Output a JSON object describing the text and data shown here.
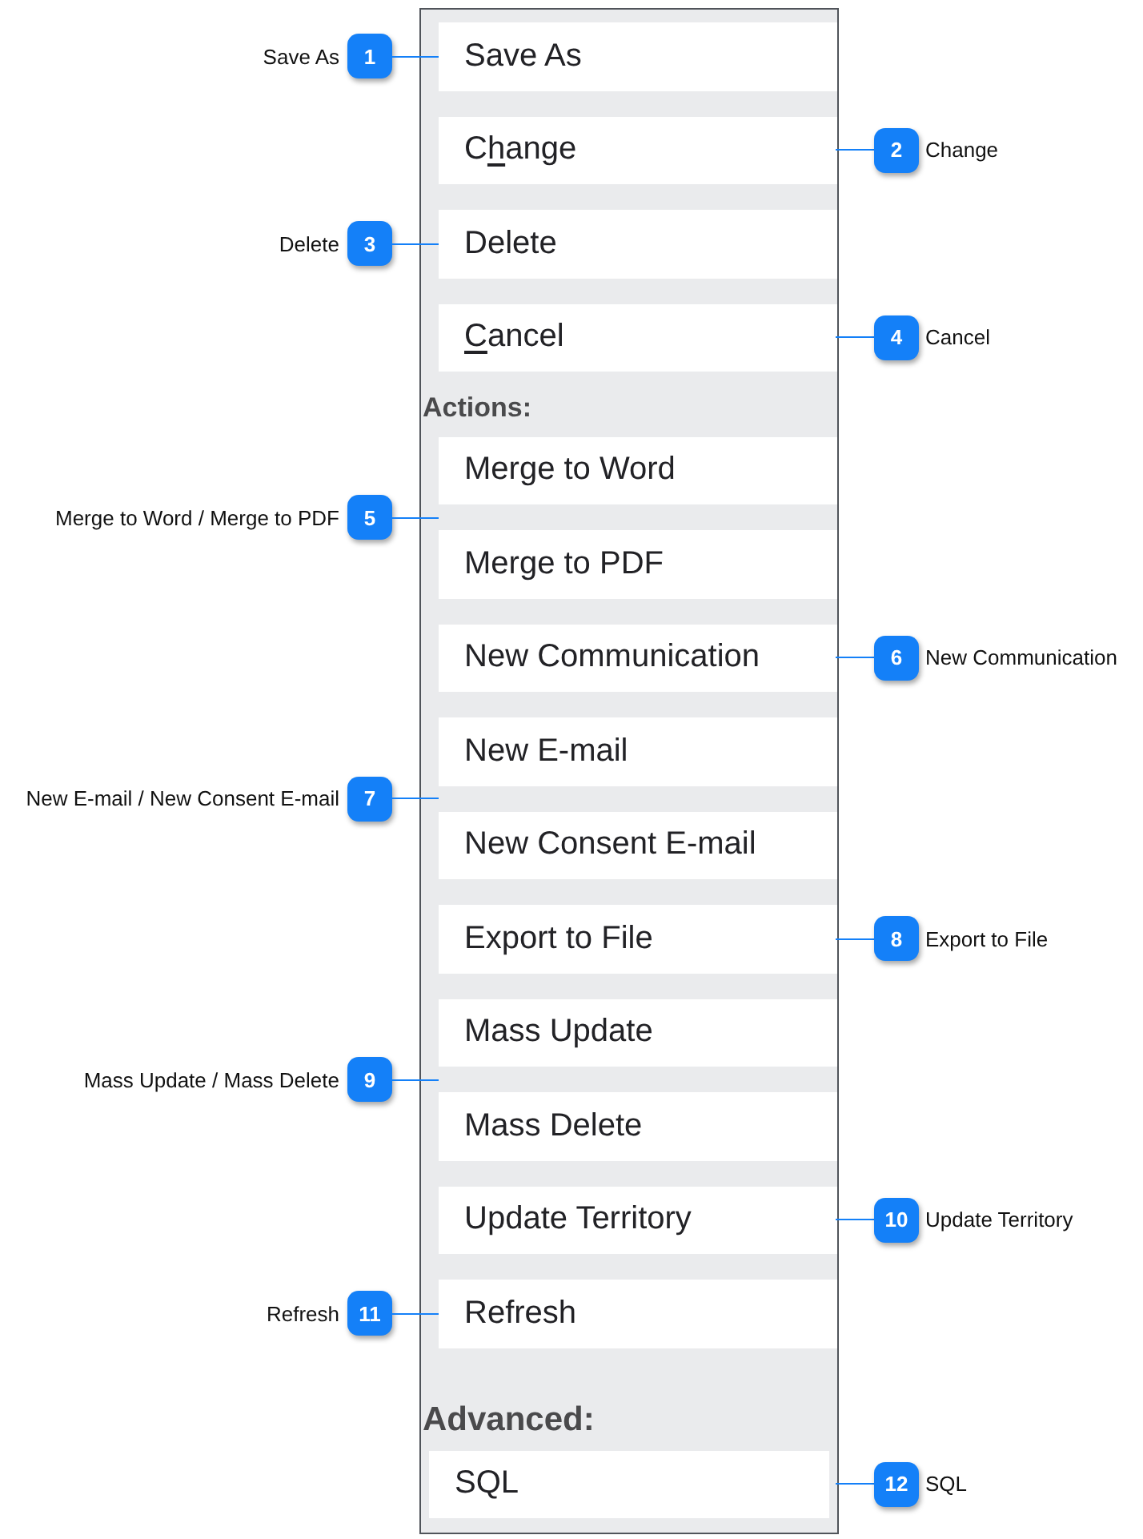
{
  "panel": {
    "sections": [
      {
        "kind": "basic",
        "entries": [
          {
            "buttons": [
              {
                "label": [
                  {
                    "text": "Save As",
                    "underlined": false
                  }
                ]
              }
            ],
            "callout": {
              "number": "1",
              "label": "Save As",
              "left": true
            }
          },
          {
            "buttons": [
              {
                "label": [
                  {
                    "text": "C",
                    "underlined": false
                  },
                  {
                    "text": "h",
                    "underlined": true
                  },
                  {
                    "text": "ange",
                    "underlined": false
                  }
                ]
              }
            ],
            "callout": {
              "number": "2",
              "label": "Change",
              "left": false
            }
          },
          {
            "buttons": [
              {
                "label": [
                  {
                    "text": "Delete",
                    "underlined": false
                  }
                ]
              }
            ],
            "callout": {
              "number": "3",
              "label": "Delete",
              "left": true
            }
          },
          {
            "buttons": [
              {
                "label": [
                  {
                    "text": "C",
                    "underlined": true
                  },
                  {
                    "text": "ancel",
                    "underlined": false
                  }
                ]
              }
            ],
            "callout": {
              "number": "4",
              "label": "Cancel",
              "left": false
            }
          }
        ]
      },
      {
        "kind": "list",
        "heading": "Actions:",
        "entries": [
          {
            "buttons": [
              {
                "label": [
                  {
                    "text": "Merge to Word",
                    "underlined": false
                  }
                ]
              },
              {
                "label": [
                  {
                    "text": "Merge to PDF",
                    "underlined": false
                  }
                ]
              }
            ],
            "callout": {
              "number": "5",
              "label": "Merge to Word / Merge to PDF",
              "left": true
            }
          },
          {
            "buttons": [
              {
                "label": [
                  {
                    "text": "New Communication",
                    "underlined": false
                  }
                ]
              }
            ],
            "callout": {
              "number": "6",
              "label": "New Communication",
              "left": false
            }
          },
          {
            "buttons": [
              {
                "label": [
                  {
                    "text": "New E-mail",
                    "underlined": false
                  }
                ]
              },
              {
                "label": [
                  {
                    "text": "New Consent E-mail",
                    "underlined": false
                  }
                ]
              }
            ],
            "callout": {
              "number": "7",
              "label": "New E-mail / New Consent E-mail",
              "left": true
            }
          },
          {
            "buttons": [
              {
                "label": [
                  {
                    "text": "Export to File",
                    "underlined": false
                  }
                ]
              }
            ],
            "callout": {
              "number": "8",
              "label": "Export to File",
              "left": false
            }
          },
          {
            "buttons": [
              {
                "label": [
                  {
                    "text": "Mass Update",
                    "underlined": false
                  }
                ]
              },
              {
                "label": [
                  {
                    "text": "Mass Delete",
                    "underlined": false
                  }
                ]
              }
            ],
            "callout": {
              "number": "9",
              "label": "Mass Update / Mass Delete",
              "left": true
            }
          },
          {
            "buttons": [
              {
                "label": [
                  {
                    "text": "Update Territory",
                    "underlined": false
                  }
                ]
              }
            ],
            "callout": {
              "number": "10",
              "label": "Update Territory",
              "left": false
            }
          },
          {
            "buttons": [
              {
                "label": [
                  {
                    "text": "Refresh",
                    "underlined": false
                  }
                ]
              }
            ],
            "callout": {
              "number": "11",
              "label": "Refresh",
              "left": true
            }
          }
        ]
      },
      {
        "kind": "advanced",
        "heading": "Advanced:",
        "entries": [
          {
            "buttons": [
              {
                "label": [
                  {
                    "text": "SQL",
                    "underlined": false
                  }
                ]
              }
            ],
            "callout": {
              "number": "12",
              "label": "SQL",
              "left": false
            }
          }
        ]
      }
    ]
  }
}
